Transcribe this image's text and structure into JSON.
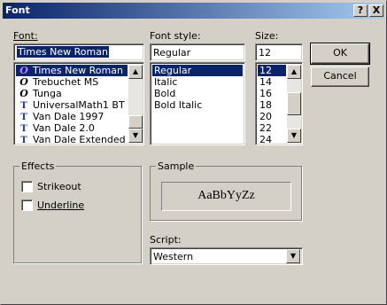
{
  "window": {
    "title": "Font",
    "help_label": "?",
    "close_label": "X"
  },
  "font": {
    "label": "Font:",
    "value": "Times New Roman",
    "items": [
      {
        "name": "Times New Roman",
        "icon": "opentype-icon",
        "selected": true
      },
      {
        "name": "Trebuchet MS",
        "icon": "opentype-icon",
        "selected": false
      },
      {
        "name": "Tunga",
        "icon": "opentype-icon",
        "selected": false
      },
      {
        "name": "UniversalMath1 BT",
        "icon": "truetype-icon",
        "selected": false
      },
      {
        "name": "Van Dale 1997",
        "icon": "truetype-icon",
        "selected": false
      },
      {
        "name": "Van Dale 2.0",
        "icon": "truetype-icon",
        "selected": false
      },
      {
        "name": "Van Dale Extended",
        "icon": "truetype-icon",
        "selected": false
      }
    ]
  },
  "style": {
    "label": "Font style:",
    "value": "Regular",
    "items": [
      "Regular",
      "Italic",
      "Bold",
      "Bold Italic"
    ],
    "selected_index": 0
  },
  "size": {
    "label": "Size:",
    "value": "12",
    "items": [
      "12",
      "14",
      "16",
      "18",
      "20",
      "22",
      "24"
    ],
    "selected_index": 0
  },
  "buttons": {
    "ok": "OK",
    "cancel": "Cancel"
  },
  "effects": {
    "label": "Effects",
    "strikeout": {
      "label": "Strikeout",
      "checked": false
    },
    "underline": {
      "label": "Underline",
      "checked": false
    }
  },
  "sample": {
    "label": "Sample",
    "text": "AaBbYyZz"
  },
  "script": {
    "label": "Script:",
    "value": "Western"
  },
  "colors": {
    "selection": "#0a246a",
    "face": "#d4d0c8"
  }
}
